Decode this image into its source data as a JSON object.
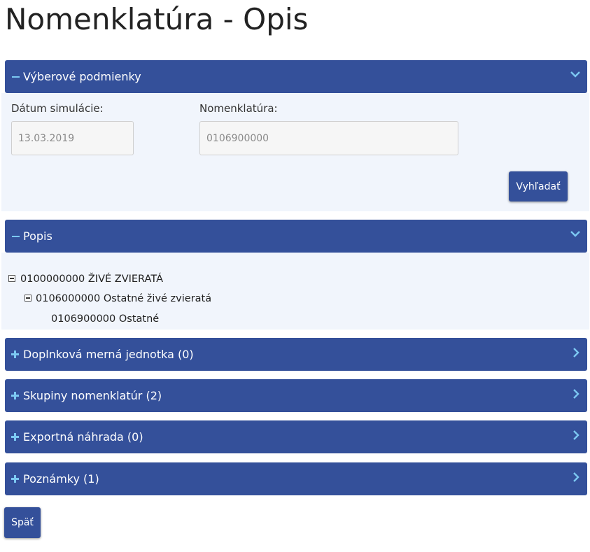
{
  "page": {
    "title": "Nomenklatúra - Opis"
  },
  "criteria": {
    "header": "Výberové podmienky",
    "date_label": "Dátum simulácie:",
    "date_value": "13.03.2019",
    "nomenclature_label": "Nomenklatúra:",
    "nomenclature_value": "0106900000",
    "search_button": "Vyhľadať"
  },
  "description": {
    "header": "Popis",
    "tree": [
      {
        "label": "0100000000 ŽIVÉ ZVIERATÁ",
        "level": 0,
        "expanded": true
      },
      {
        "label": "0106000000 Ostatné živé zvieratá",
        "level": 1,
        "expanded": true
      },
      {
        "label": "0106900000 Ostatné",
        "level": 2,
        "expanded": false
      }
    ]
  },
  "sections": [
    {
      "label": "Doplnková merná jednotka (0)"
    },
    {
      "label": "Skupiny nomenklatúr (2)"
    },
    {
      "label": "Exportná náhrada (0)"
    },
    {
      "label": "Poznámky (1)"
    }
  ],
  "back_button": "Späť",
  "colors": {
    "header_bg": "#34509a",
    "body_bg": "#f1f5fc",
    "icon_accent": "#7cc8f2"
  },
  "icons": {
    "collapse": "minus-icon",
    "expand": "plus-icon",
    "expanded_indicator": "chevron-down-icon",
    "collapsed_indicator": "chevron-right-icon",
    "tree_collapse": "tree-minus-icon"
  }
}
